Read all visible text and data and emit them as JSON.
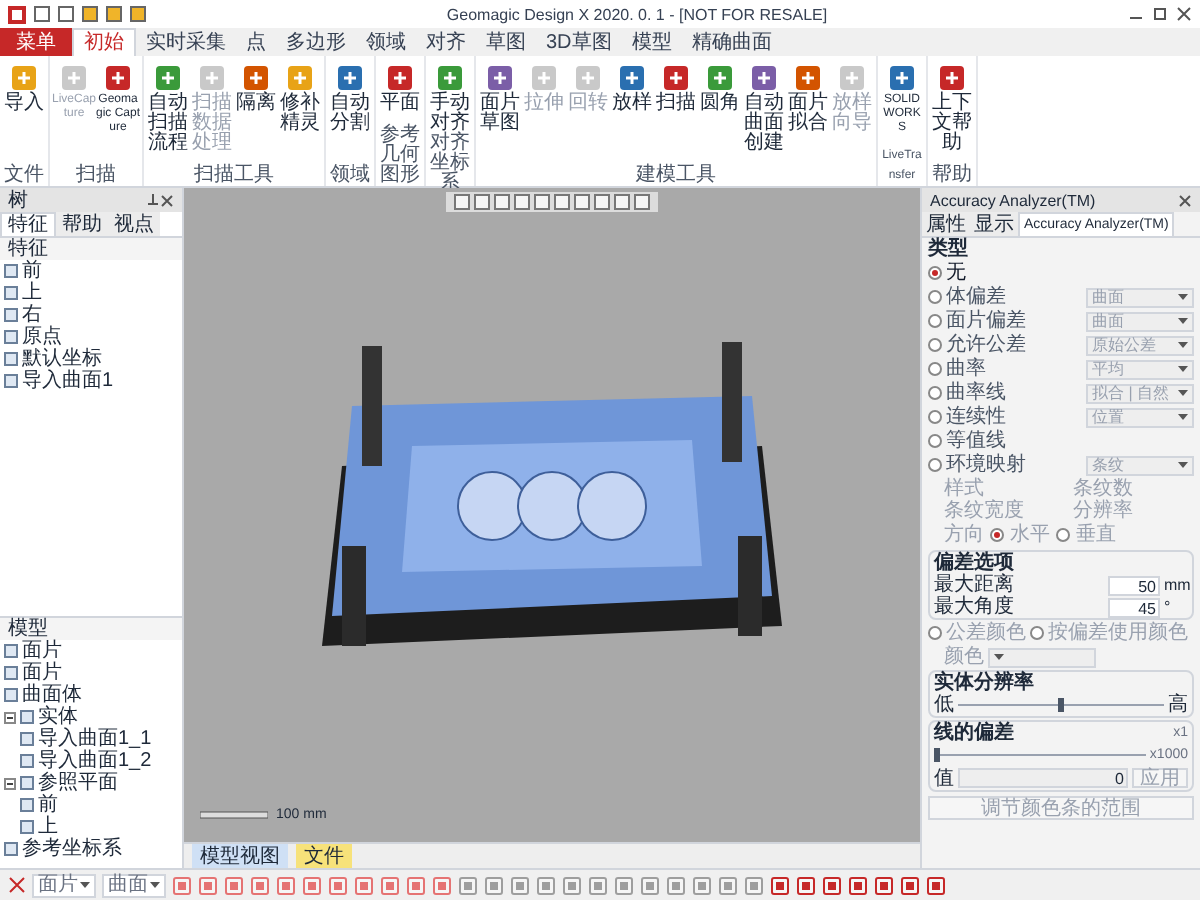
{
  "window": {
    "title": "Geomagic Design X 2020. 0. 1 - [NOT FOR RESALE]"
  },
  "ribbon_tabs": [
    {
      "label": "菜单",
      "selected": false,
      "kind": "menu"
    },
    {
      "label": "初始",
      "selected": true,
      "kind": "tab"
    },
    {
      "label": "实时采集",
      "selected": false,
      "kind": "tab"
    },
    {
      "label": "点",
      "selected": false,
      "kind": "tab"
    },
    {
      "label": "多边形",
      "selected": false,
      "kind": "tab"
    },
    {
      "label": "领域",
      "selected": false,
      "kind": "tab"
    },
    {
      "label": "对齐",
      "selected": false,
      "kind": "tab"
    },
    {
      "label": "草图",
      "selected": false,
      "kind": "tab"
    },
    {
      "label": "3D草图",
      "selected": false,
      "kind": "tab"
    },
    {
      "label": "模型",
      "selected": false,
      "kind": "tab"
    },
    {
      "label": "精确曲面",
      "selected": false,
      "kind": "tab"
    }
  ],
  "ribbon_groups": [
    {
      "label": "文件",
      "buttons": [
        {
          "label": "导入",
          "disabled": false
        }
      ]
    },
    {
      "label": "扫描",
      "buttons": [
        {
          "label": "LiveCapture",
          "disabled": true
        },
        {
          "label": "Geomagic Capture",
          "disabled": false
        }
      ]
    },
    {
      "label": "扫描工具",
      "buttons": [
        {
          "label": "自动扫描流程",
          "disabled": false
        },
        {
          "label": "扫描数据处理",
          "disabled": true
        },
        {
          "label": "隔离",
          "disabled": false
        },
        {
          "label": "修补精灵",
          "disabled": false
        }
      ]
    },
    {
      "label": "领域",
      "buttons": [
        {
          "label": "自动分割",
          "disabled": false
        }
      ]
    },
    {
      "label": "参考几何图形",
      "buttons": [
        {
          "label": "平面",
          "disabled": false
        }
      ]
    },
    {
      "label": "对齐坐标系",
      "buttons": [
        {
          "label": "手动对齐",
          "disabled": false
        }
      ]
    },
    {
      "label": "建模工具",
      "buttons": [
        {
          "label": "面片草图",
          "disabled": false
        },
        {
          "label": "拉伸",
          "disabled": true
        },
        {
          "label": "回转",
          "disabled": true
        },
        {
          "label": "放样",
          "disabled": false
        },
        {
          "label": "扫描",
          "disabled": false
        },
        {
          "label": "圆角",
          "disabled": false
        },
        {
          "label": "自动曲面创建",
          "disabled": false
        },
        {
          "label": "面片拟合",
          "disabled": false
        },
        {
          "label": "放样向导",
          "disabled": true
        }
      ]
    },
    {
      "label": "LiveTransfer",
      "buttons": [
        {
          "label": "SOLIDWORKS",
          "disabled": false
        }
      ]
    },
    {
      "label": "帮助",
      "buttons": [
        {
          "label": "上下文帮助",
          "disabled": false
        }
      ]
    }
  ],
  "left_panel": {
    "title": "树",
    "tabs": [
      {
        "label": "特征",
        "selected": true
      },
      {
        "label": "帮助",
        "selected": false
      },
      {
        "label": "视点",
        "selected": false
      }
    ],
    "feature_tree": {
      "title": "特征",
      "items": [
        {
          "label": "前"
        },
        {
          "label": "上"
        },
        {
          "label": "右"
        },
        {
          "label": "原点"
        },
        {
          "label": "默认坐标"
        },
        {
          "label": "导入曲面1"
        }
      ]
    },
    "model_tree": {
      "title": "模型",
      "items": [
        {
          "label": "面片"
        },
        {
          "label": "面片"
        },
        {
          "label": "曲面体"
        },
        {
          "label": "实体",
          "children": [
            {
              "label": "导入曲面1_1"
            },
            {
              "label": "导入曲面1_2"
            }
          ]
        },
        {
          "label": "参照平面",
          "children": [
            {
              "label": "前"
            },
            {
              "label": "上"
            }
          ]
        },
        {
          "label": "参考坐标系"
        }
      ]
    }
  },
  "viewport": {
    "scale_label": "100 mm",
    "tabs": [
      {
        "label": "模型视图",
        "selected": true
      },
      {
        "label": "文件",
        "selected": false
      }
    ]
  },
  "right_panel": {
    "title": "Accuracy Analyzer(TM)",
    "tabs": [
      {
        "label": "属性",
        "selected": false
      },
      {
        "label": "显示",
        "selected": false
      },
      {
        "label": "Accuracy Analyzer(TM)",
        "selected": true
      }
    ],
    "type_title": "类型",
    "types": [
      {
        "label": "无",
        "selected": true
      },
      {
        "label": "体偏差",
        "selected": false,
        "value": "曲面"
      },
      {
        "label": "面片偏差",
        "selected": false,
        "value": "曲面"
      },
      {
        "label": "允许公差",
        "selected": false,
        "value": "原始公差"
      },
      {
        "label": "曲率",
        "selected": false,
        "value": "平均"
      },
      {
        "label": "曲率线",
        "selected": false,
        "value": "拟合 | 自然"
      },
      {
        "label": "连续性",
        "selected": false,
        "value": "位置"
      },
      {
        "label": "等值线",
        "selected": false
      },
      {
        "label": "环境映射",
        "selected": false,
        "value": "条纹"
      }
    ],
    "stripe_fields": [
      "样式",
      "条纹数",
      "条纹宽度",
      "分辨率"
    ],
    "direction": {
      "label": "方向",
      "options": [
        {
          "label": "水平",
          "selected": true
        },
        {
          "label": "垂直",
          "selected": false
        }
      ]
    },
    "deviation": {
      "title": "偏差选项",
      "rows": [
        {
          "label": "最大距离",
          "value": "50",
          "unit": "mm"
        },
        {
          "label": "最大角度",
          "value": "45",
          "unit": "°"
        }
      ]
    },
    "color": {
      "options": [
        {
          "label": "公差颜色",
          "selected": false
        },
        {
          "label": "按偏差使用颜色",
          "selected": false
        }
      ],
      "label": "颜色"
    },
    "resolution": {
      "title": "实体分辨率",
      "low": "低",
      "high": "高",
      "level": 0.5
    },
    "line_deviation": {
      "title": "线的偏差",
      "min": "x1",
      "max": "x1000",
      "level": 0.0,
      "value_label": "值",
      "value": "0",
      "apply": "应用"
    },
    "adjust_button": "调节颜色条的范围"
  },
  "bottom_toolbar": {
    "selectors": [
      "面片",
      "曲面"
    ]
  }
}
